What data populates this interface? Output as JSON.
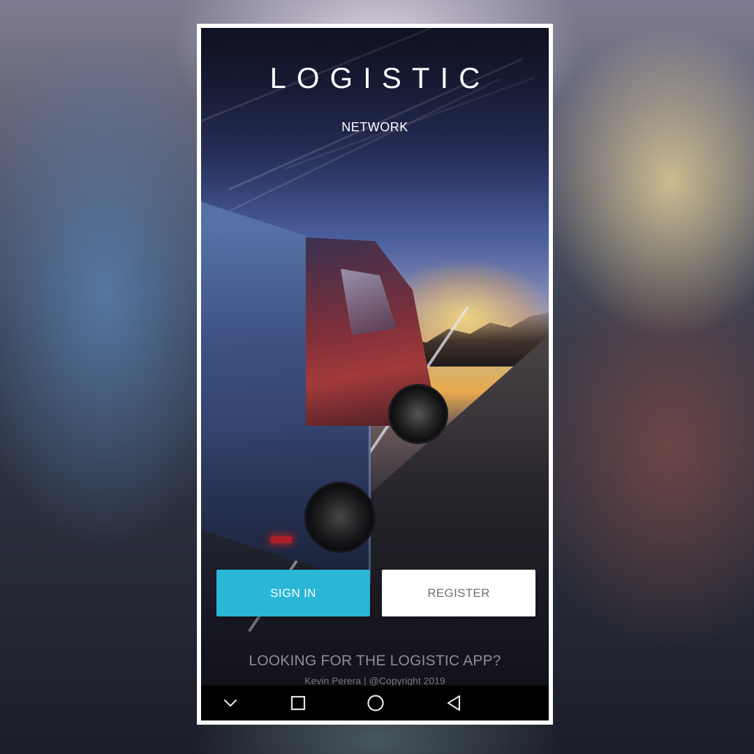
{
  "app": {
    "title": "LOGISTIC",
    "subtitle": "NETWORK"
  },
  "buttons": {
    "sign_in": "SIGN IN",
    "register": "REGISTER"
  },
  "footer": {
    "link_text": "LOOKING FOR THE LOGISTIC APP?",
    "copyright": "Kevin Perera | @Copyright 2019"
  },
  "navbar": {
    "icons": [
      "chevron-down-icon",
      "recents-square-icon",
      "home-circle-icon",
      "back-triangle-icon"
    ]
  },
  "colors": {
    "accent": "#2ab6d6",
    "register_bg": "#ffffff",
    "register_text": "#6d6d6d",
    "footer_text": "#8e8e99",
    "navbar_bg": "#000000"
  }
}
